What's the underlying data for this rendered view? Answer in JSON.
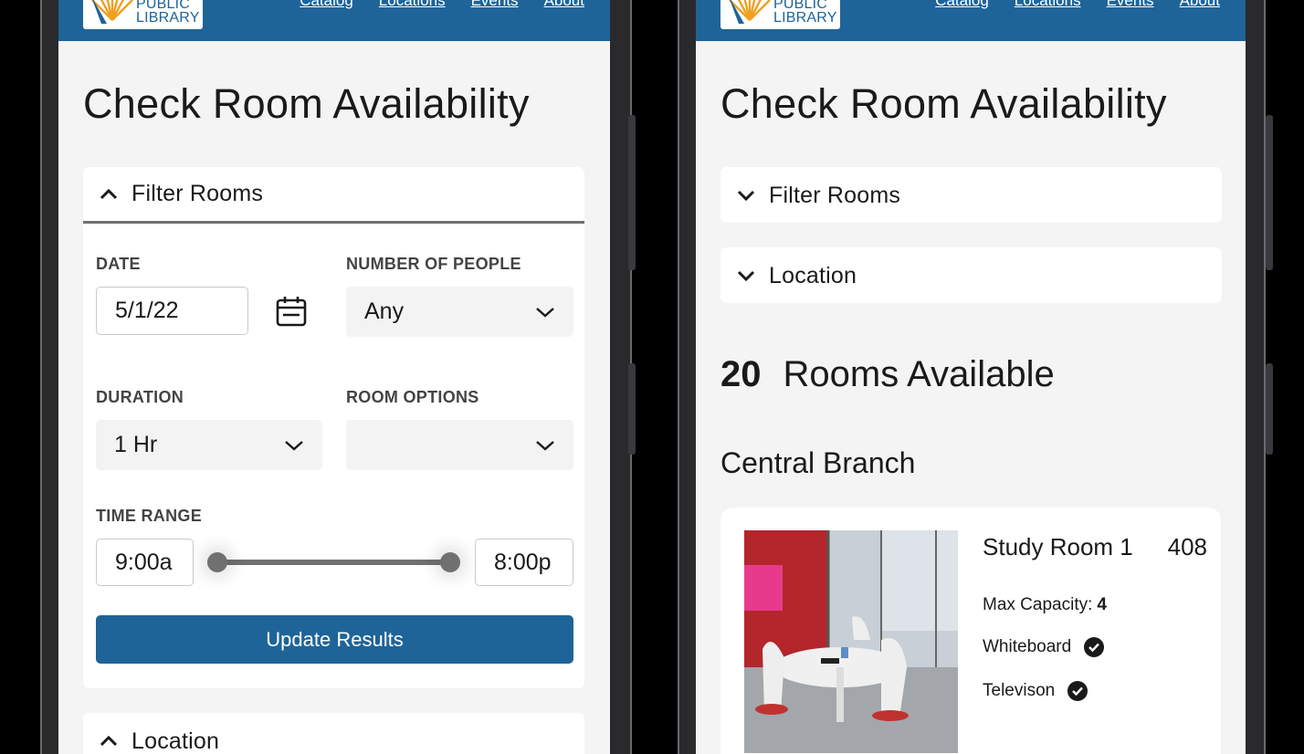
{
  "header": {
    "logo": {
      "line1": "PUBLIC",
      "line2": "LIBRARY"
    },
    "nav": [
      "Catalog",
      "Locations",
      "Events",
      "About"
    ]
  },
  "colors": {
    "brand": "#1e6499",
    "screen_bg": "#f4f4f4"
  },
  "left_screen": {
    "page_title": "Check Room Availability",
    "filter_panel": {
      "label": "Filter Rooms",
      "state": "expanded",
      "date": {
        "label": "DATE",
        "value": "5/1/22",
        "icon": "calendar-icon"
      },
      "number_of_people": {
        "label": "NUMBER OF PEOPLE",
        "value": "Any"
      },
      "duration": {
        "label": "DURATION",
        "value": "1 Hr"
      },
      "room_options": {
        "label": "ROOM OPTIONS",
        "value": ""
      },
      "time_range": {
        "label": "TIME RANGE",
        "start": "9:00a",
        "end": "8:00p"
      },
      "submit_label": "Update Results"
    },
    "location_panel": {
      "label": "Location",
      "state": "expanded"
    }
  },
  "right_screen": {
    "page_title": "Check Room Availability",
    "filter_panel": {
      "label": "Filter Rooms",
      "state": "collapsed"
    },
    "location_panel": {
      "label": "Location",
      "state": "collapsed"
    },
    "results": {
      "count": "20",
      "label": "Rooms Available"
    },
    "branch": "Central Branch",
    "room": {
      "name": "Study Room 1",
      "number": "408",
      "capacity_label": "Max Capacity:",
      "capacity_value": "4",
      "amenities": [
        "Whiteboard",
        "Televison"
      ]
    }
  }
}
